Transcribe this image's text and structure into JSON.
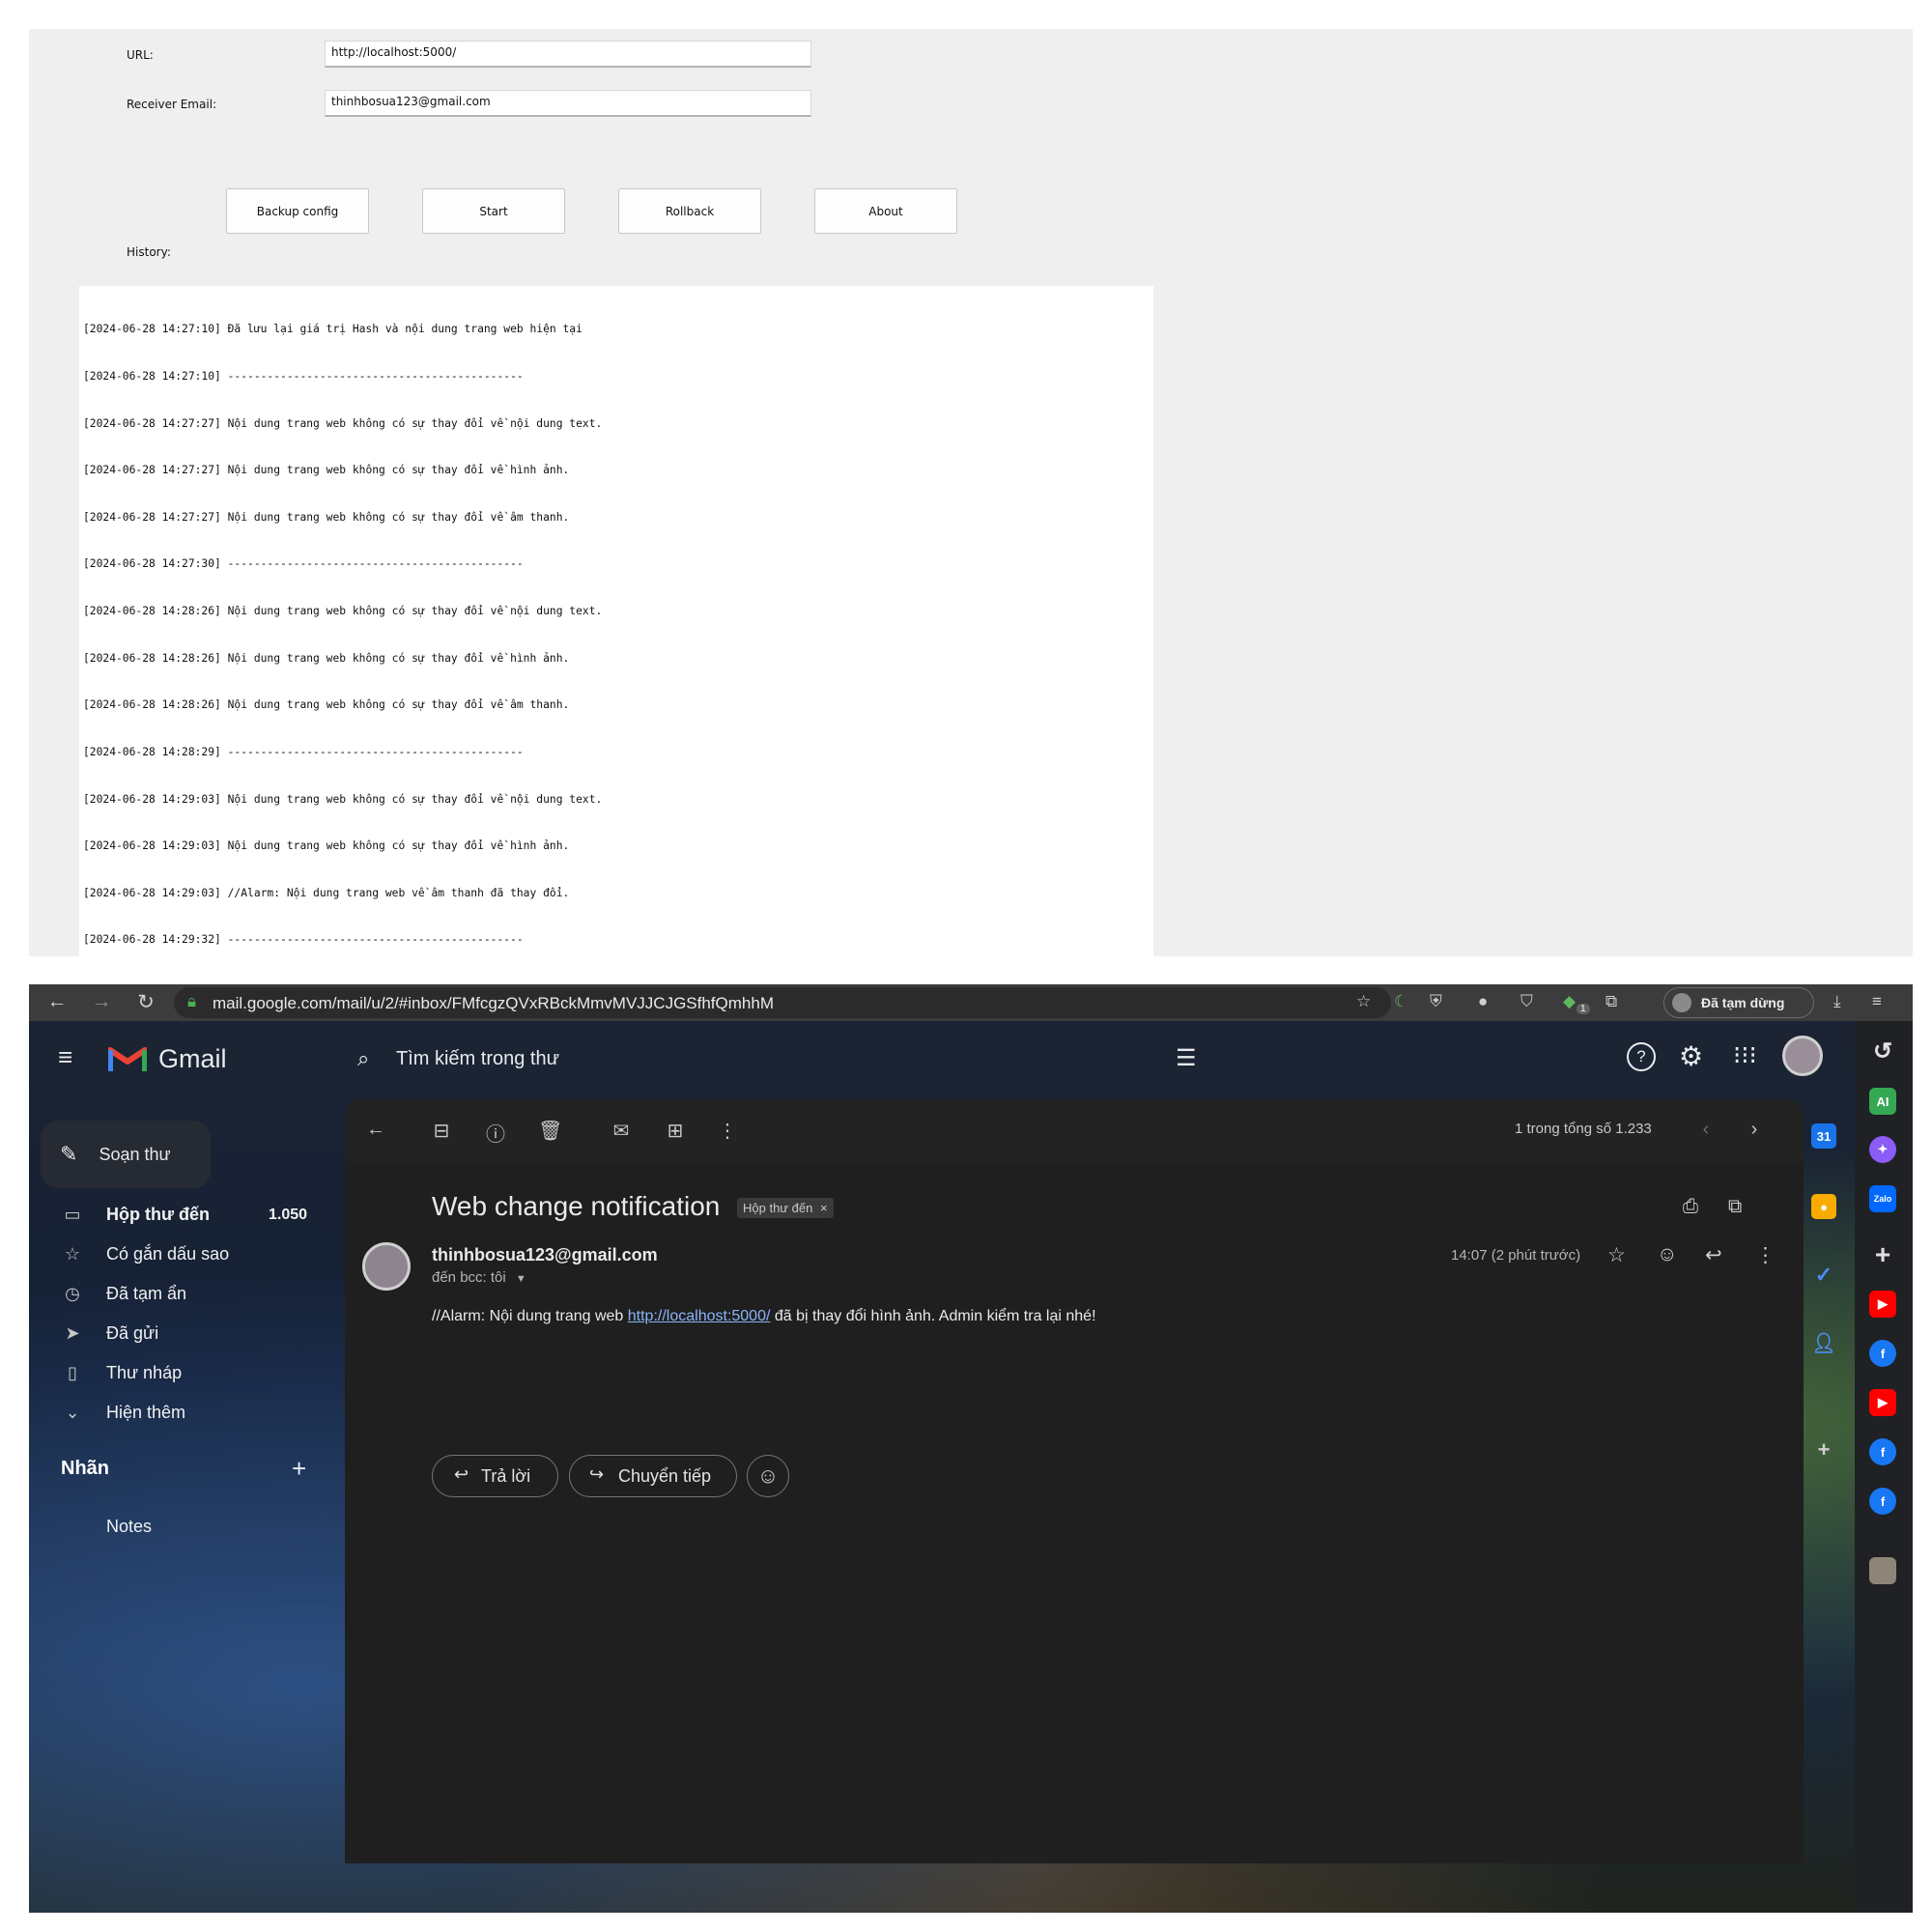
{
  "app": {
    "url_label": "URL:",
    "url_value": "http://localhost:5000/",
    "email_label": "Receiver Email:",
    "email_value": "thinhbosua123@gmail.com",
    "buttons": [
      "Backup config",
      "Start",
      "Rollback",
      "About"
    ],
    "history_label": "History:",
    "history_lines": [
      "[2024-06-28 14:27:10] Đã lưu lại giá trị Hash và nội dung trang web hiện tại",
      "[2024-06-28 14:27:10] ---------------------------------------------",
      "[2024-06-28 14:27:27] Nội dung trang web không có sự thay đổi về nội dung text.",
      "[2024-06-28 14:27:27] Nội dung trang web không có sự thay đổi về hình ảnh.",
      "[2024-06-28 14:27:27] Nội dung trang web không có sự thay đổi về âm thanh.",
      "[2024-06-28 14:27:30] ---------------------------------------------",
      "[2024-06-28 14:28:26] Nội dung trang web không có sự thay đổi về nội dung text.",
      "[2024-06-28 14:28:26] Nội dung trang web không có sự thay đổi về hình ảnh.",
      "[2024-06-28 14:28:26] Nội dung trang web không có sự thay đổi về âm thanh.",
      "[2024-06-28 14:28:29] ---------------------------------------------",
      "[2024-06-28 14:29:03] Nội dung trang web không có sự thay đổi về nội dung text.",
      "[2024-06-28 14:29:03] Nội dung trang web không có sự thay đổi về hình ảnh.",
      "[2024-06-28 14:29:03] //Alarm: Nội dung trang web về âm thanh đã thay đổi.",
      "[2024-06-28 14:29:32] ---------------------------------------------"
    ]
  },
  "browser": {
    "url": "mail.google.com/mail/u/2/#inbox/FMfcgzQVxRBckMmvMVJJCJGSfhfQmhhM",
    "paused_label": "Đã tạm dừng",
    "ext_badge": "1"
  },
  "gmail": {
    "logo_text": "Gmail",
    "search_placeholder": "Tìm kiếm trong thư",
    "compose_label": "Soạn thư",
    "sidebar": [
      {
        "label": "Hộp thư đến",
        "count": "1.050",
        "icon": "inbox-icon"
      },
      {
        "label": "Có gắn dấu sao",
        "icon": "star-icon"
      },
      {
        "label": "Đã tạm ẩn",
        "icon": "clock-icon"
      },
      {
        "label": "Đã gửi",
        "icon": "send-icon"
      },
      {
        "label": "Thư nháp",
        "icon": "draft-icon"
      },
      {
        "label": "Hiện thêm",
        "icon": "chevron-down-icon"
      }
    ],
    "labels_heading": "Nhãn",
    "labels": [
      "Notes"
    ],
    "pagination": "1 trong tổng số 1.233",
    "subject": "Web change notification",
    "label_chip": "Hộp thư đến",
    "sender": "thinhbosua123@gmail.com",
    "recipient": "đến bcc: tôi",
    "time": "14:07 (2 phút trước)",
    "body_prefix": "//Alarm: Nội dung trang web ",
    "body_link": "http://localhost:5000/",
    "body_suffix": " đã bị thay đổi hình ảnh. Admin kiểm tra lại nhé!",
    "reply_label": "Trả lời",
    "forward_label": "Chuyển tiếp"
  },
  "colors": {
    "app_bg": "#efefef",
    "gmail_pane": "#1f1f1f",
    "link": "#8ab4f8",
    "gmail_red": "#ea4335"
  }
}
